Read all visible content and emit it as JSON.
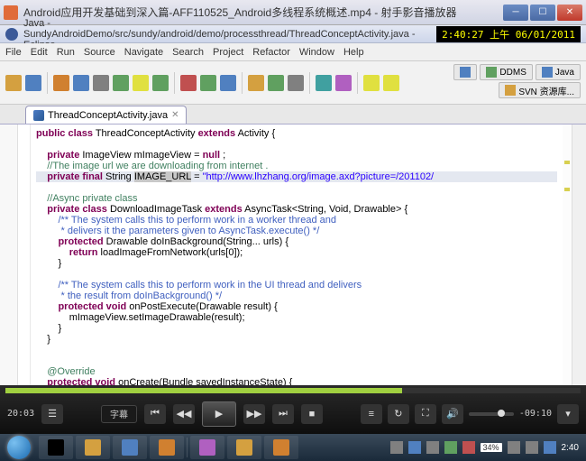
{
  "outer_window": {
    "title": "Android应用开发基础到深入篇-AFF110525_Android多线程系统概述.mp4 - 射手影音播放器"
  },
  "eclipse": {
    "title": "Java - SundyAndroidDemo/src/sundy/android/demo/processthread/ThreadConceptActivity.java - Eclipse",
    "clock": "2:40:27 上午 06/01/2011",
    "menu": [
      "File",
      "Edit",
      "Run",
      "Source",
      "Navigate",
      "Search",
      "Project",
      "Refactor",
      "Window",
      "Help"
    ],
    "perspectives": {
      "ddms": "DDMS",
      "java": "Java",
      "svn": "SVN 资源库..."
    },
    "tab": {
      "name": "ThreadConceptActivity.java"
    }
  },
  "code": {
    "l1a": "public",
    "l1b": " class",
    "l1c": " ThreadConceptActivity ",
    "l1d": "extends",
    "l1e": " Activity {",
    "l2a": "private",
    "l2b": " ImageView mImageView = ",
    "l2c": "null",
    "l2d": " ;",
    "l3": "//The image url we are downloading from internet .",
    "l4a": "private",
    "l4b": " final",
    "l4c": " String ",
    "l4d": "IMAGE_URL",
    "l4e": " = ",
    "l4f": "\"http://www.lhzhang.org/image.axd?picture=/201102/",
    "l5": "//Async private class",
    "l6a": "private",
    "l6b": " class",
    "l6c": " DownloadImageTask ",
    "l6d": "extends",
    "l6e": " AsyncTask<String, Void, Drawable> {",
    "l7": "/** The system calls this to perform work in a worker thread and",
    "l8": " * delivers it the parameters given to AsyncTask.execute() */",
    "l9a": "protected",
    "l9b": " Drawable doInBackground(String... urls) {",
    "l10a": "return",
    "l10b": " loadImageFromNetwork(urls[0]);",
    "l11": "}",
    "l12": "/** The system calls this to perform work in the UI thread and delivers",
    "l13": " * the result from doInBackground() */",
    "l14a": "protected",
    "l14b": " void",
    "l14c": " onPostExecute(Drawable result) {",
    "l15": "mImageView.setImageDrawable(result);",
    "l16": "}",
    "l17": "}",
    "l18": "@Override",
    "l19a": "protected",
    "l19b": " void",
    "l19c": " onCreate(Bundle savedInstanceState) {"
  },
  "player": {
    "elapsed": "20:03",
    "remaining": "-09:10",
    "subtitle_btn": "字幕",
    "progress_pct": 69
  },
  "taskbar": {
    "battery": "34%",
    "clock": "2:40"
  }
}
